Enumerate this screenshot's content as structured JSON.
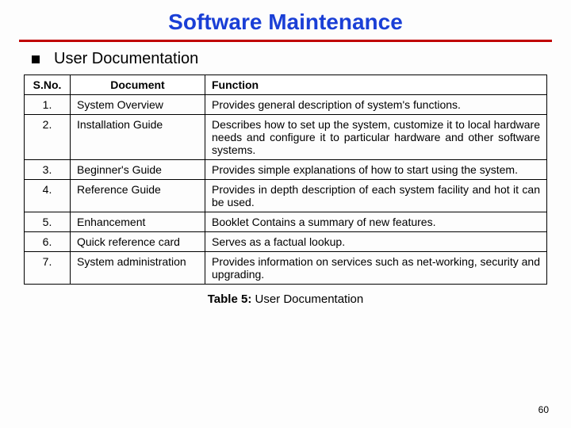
{
  "title": "Software Maintenance",
  "subtitle": "User Documentation",
  "headers": {
    "sno": "S.No.",
    "doc": "Document",
    "fun": "Function"
  },
  "rows": [
    {
      "sno": "1.",
      "doc": "System Overview",
      "fun": "Provides general description of system's functions."
    },
    {
      "sno": "2.",
      "doc": "Installation Guide",
      "fun": "Describes how to set up the system, customize it to local hardware needs and configure it to particular hardware and other software systems."
    },
    {
      "sno": "3.",
      "doc": "Beginner's Guide",
      "fun": "Provides simple explanations of how to start using the system."
    },
    {
      "sno": "4.",
      "doc": "Reference Guide",
      "fun": "Provides in depth description of each system facility and hot it can be used."
    },
    {
      "sno": "5.",
      "doc": "Enhancement",
      "fun": "Booklet Contains a summary of new features."
    },
    {
      "sno": "6.",
      "doc": "Quick reference card",
      "fun": "Serves as a factual lookup."
    },
    {
      "sno": "7.",
      "doc": "System administration",
      "fun": "Provides information on services such as net-working, security and upgrading."
    }
  ],
  "caption_bold": "Table 5:",
  "caption_rest": " User Documentation",
  "page_number": "60"
}
